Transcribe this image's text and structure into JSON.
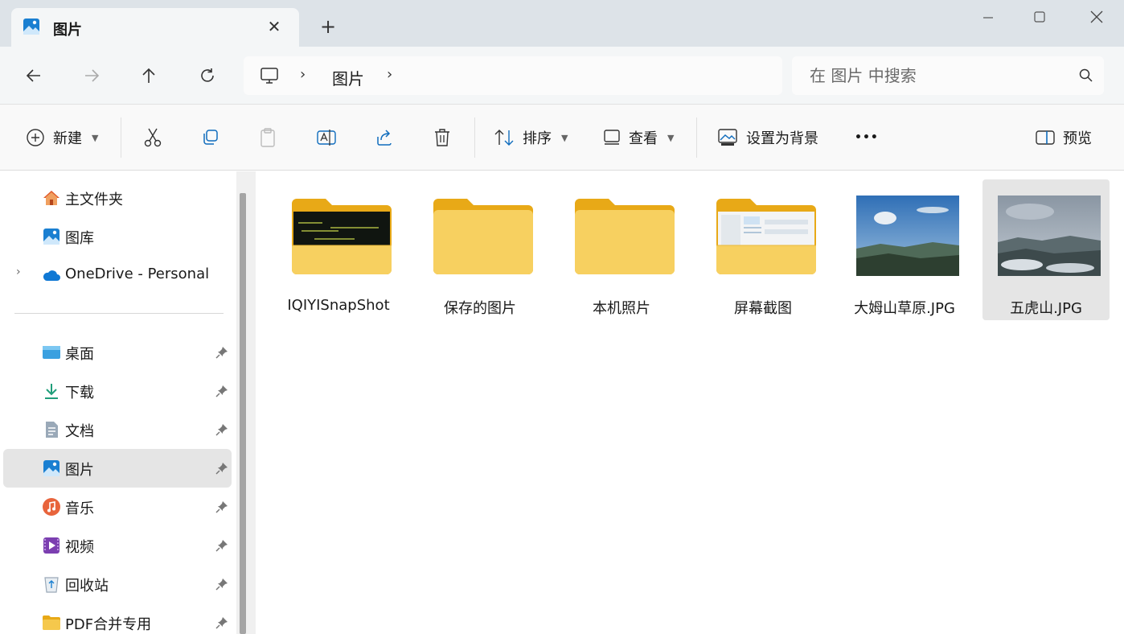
{
  "tab": {
    "title": "图片",
    "close": "✕",
    "new": "+"
  },
  "address": {
    "separator": "›",
    "crumb": "图片"
  },
  "search": {
    "placeholder": "在 图片 中搜索"
  },
  "commands": {
    "new": "新建",
    "sort": "排序",
    "view": "查看",
    "set_background": "设置为背景",
    "more": "•••",
    "preview": "预览"
  },
  "sidebar": {
    "top": [
      {
        "label": "主文件夹",
        "icon": "home-icon"
      },
      {
        "label": "图库",
        "icon": "gallery-icon"
      },
      {
        "label": "OneDrive - Personal",
        "icon": "onedrive-cloud-icon",
        "expander": "›"
      }
    ],
    "pinned": [
      {
        "label": "桌面",
        "icon": "desktop-icon"
      },
      {
        "label": "下载",
        "icon": "download-icon"
      },
      {
        "label": "文档",
        "icon": "documents-icon"
      },
      {
        "label": "图片",
        "icon": "pictures-icon",
        "selected": true
      },
      {
        "label": "音乐",
        "icon": "music-icon"
      },
      {
        "label": "视频",
        "icon": "videos-icon"
      },
      {
        "label": "回收站",
        "icon": "recycle-bin-icon"
      },
      {
        "label": "PDF合并专用",
        "icon": "folder-icon"
      }
    ]
  },
  "files": [
    {
      "name": "IQIYISnapShot",
      "type": "folder-with-preview"
    },
    {
      "name": "保存的图片",
      "type": "folder"
    },
    {
      "name": "本机照片",
      "type": "folder"
    },
    {
      "name": "屏幕截图",
      "type": "folder-with-preview"
    },
    {
      "name": "大姆山草原.JPG",
      "type": "image"
    },
    {
      "name": "五虎山.JPG",
      "type": "image",
      "selected": true
    }
  ],
  "colors": {
    "folder": "#f5c84c",
    "folder_dark": "#e8a917",
    "accent": "#0f6cbd",
    "selection": "#e5e5e5"
  }
}
